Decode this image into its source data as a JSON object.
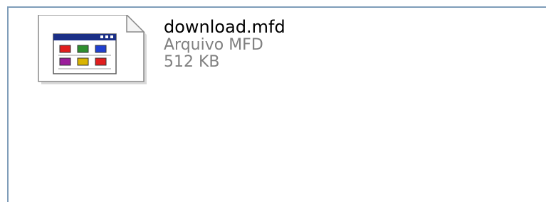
{
  "file": {
    "name": "download.mfd",
    "type": "Arquivo MFD",
    "size": "512 KB",
    "icon": "mfd-file-icon"
  },
  "colors": {
    "border": "#7f9db9",
    "name_text": "#000000",
    "meta_text": "#808080",
    "icon_title_bar": "#1b2f86",
    "icon_cells": [
      "#e11d1d",
      "#2f8f2f",
      "#1f3fd0",
      "#9b1d9b",
      "#d9b400",
      "#e11d1d"
    ]
  }
}
